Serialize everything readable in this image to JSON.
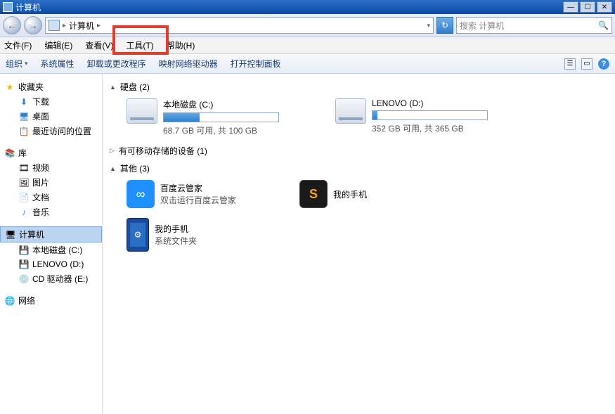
{
  "titlebar": {
    "title": "计算机"
  },
  "nav": {
    "back": "←",
    "forward": "→"
  },
  "address": {
    "crumb": "计算机",
    "sep": "▸",
    "dropdown": "▾",
    "refresh": "↻"
  },
  "search": {
    "placeholder": "搜索 计算机"
  },
  "menu": {
    "file": "文件(F)",
    "edit": "编辑(E)",
    "view": "查看(V)",
    "tools": "工具(T)",
    "help": "帮助(H)"
  },
  "toolbar": {
    "organize": "组织",
    "sysprops": "系统属性",
    "uninstall": "卸载或更改程序",
    "mapdrive": "映射网络驱动器",
    "controlpanel": "打开控制面板"
  },
  "sidebar": {
    "fav": {
      "label": "收藏夹",
      "downloads": "下载",
      "desktop": "桌面",
      "recent": "最近访问的位置"
    },
    "lib": {
      "label": "库",
      "video": "视频",
      "pictures": "图片",
      "documents": "文档",
      "music": "音乐"
    },
    "computer": {
      "label": "计算机",
      "c": "本地磁盘 (C:)",
      "d": "LENOVO (D:)",
      "cd": "CD 驱动器 (E:)"
    },
    "network": {
      "label": "网络"
    }
  },
  "content": {
    "hdd": {
      "header": "硬盘 (2)",
      "c": {
        "name": "本地磁盘 (C:)",
        "detail": "68.7 GB 可用, 共 100 GB",
        "fillpct": 31
      },
      "d": {
        "name": "LENOVO (D:)",
        "detail": "352 GB 可用, 共 365 GB",
        "fillpct": 4
      }
    },
    "removable": {
      "header": "有可移动存储的设备 (1)"
    },
    "other": {
      "header": "其他 (3)",
      "baidu": {
        "name": "百度云管家",
        "sub": "双击运行百度云管家"
      },
      "phone1": {
        "name": "我的手机"
      },
      "phone2": {
        "name": "我的手机",
        "sub": "系统文件夹"
      }
    }
  }
}
